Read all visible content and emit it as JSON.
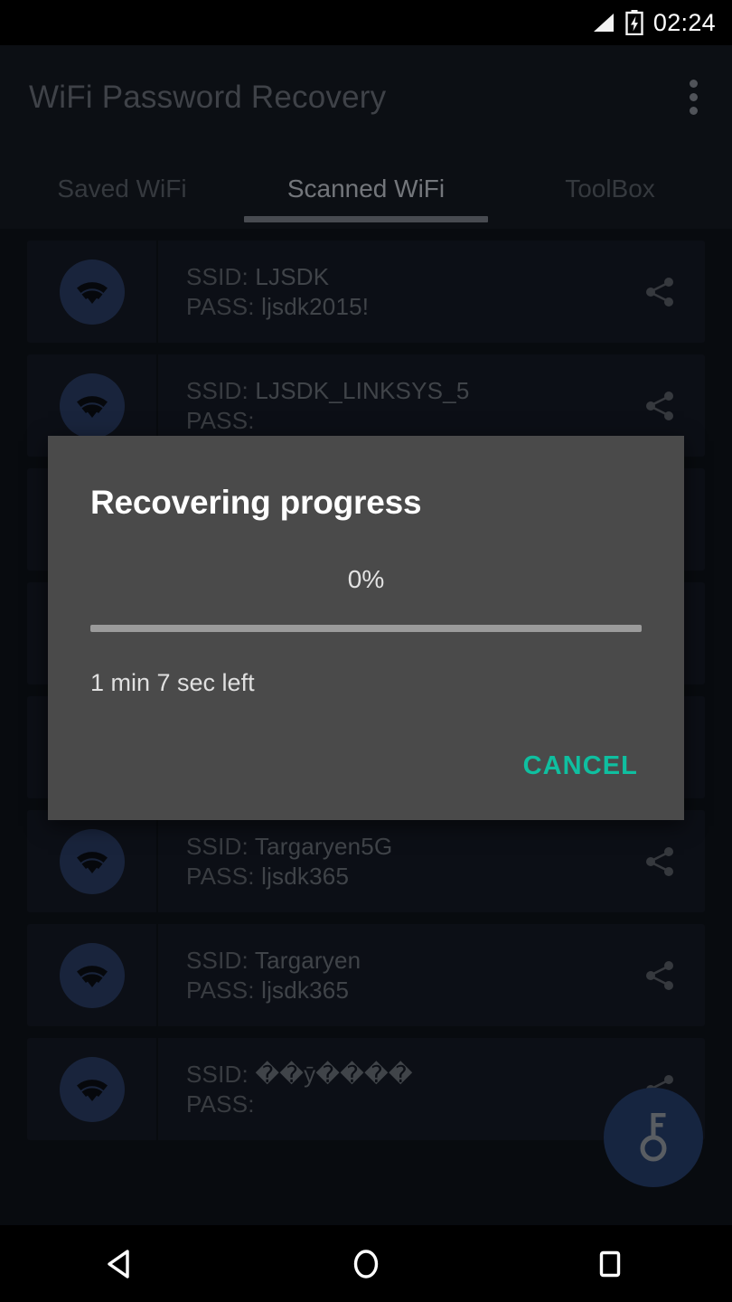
{
  "status_bar": {
    "clock": "02:24",
    "signal_icon": "signal-triangle-icon",
    "battery_icon": "battery-charging-icon"
  },
  "app_bar": {
    "title": "WiFi Password Recovery",
    "overflow_icon": "overflow-menu-icon"
  },
  "tabs": [
    {
      "label": "Saved WiFi",
      "active": false
    },
    {
      "label": "Scanned WiFi",
      "active": true
    },
    {
      "label": "ToolBox",
      "active": false
    }
  ],
  "list": {
    "ssid_label": "SSID:",
    "pass_label": "PASS:",
    "wifi_icon": "wifi-signal-icon",
    "share_icon": "share-icon",
    "rows": [
      {
        "ssid": "LJSDK",
        "pass": "ljsdk2015!"
      },
      {
        "ssid": "LJSDK_LINKSYS_5",
        "pass": ""
      },
      {
        "ssid": "",
        "pass": ""
      },
      {
        "ssid": "",
        "pass": ""
      },
      {
        "ssid": "",
        "pass": ""
      },
      {
        "ssid": "Targaryen5G",
        "pass": "ljsdk365"
      },
      {
        "ssid": "Targaryen",
        "pass": "ljsdk365"
      },
      {
        "ssid": "��ȳ����",
        "pass": ""
      }
    ]
  },
  "fab": {
    "icon": "key-icon",
    "color": "#27406f"
  },
  "dialog": {
    "title": "Recovering progress",
    "percent_label": "0%",
    "progress_value": 0,
    "eta_label": "1 min 7 sec left",
    "cancel_label": "CANCEL",
    "accent_color": "#0fbfa0",
    "background_color": "#4a4a4a"
  },
  "nav_bar": {
    "back_icon": "back-triangle-icon",
    "home_icon": "home-circle-icon",
    "recents_icon": "recents-square-icon"
  }
}
